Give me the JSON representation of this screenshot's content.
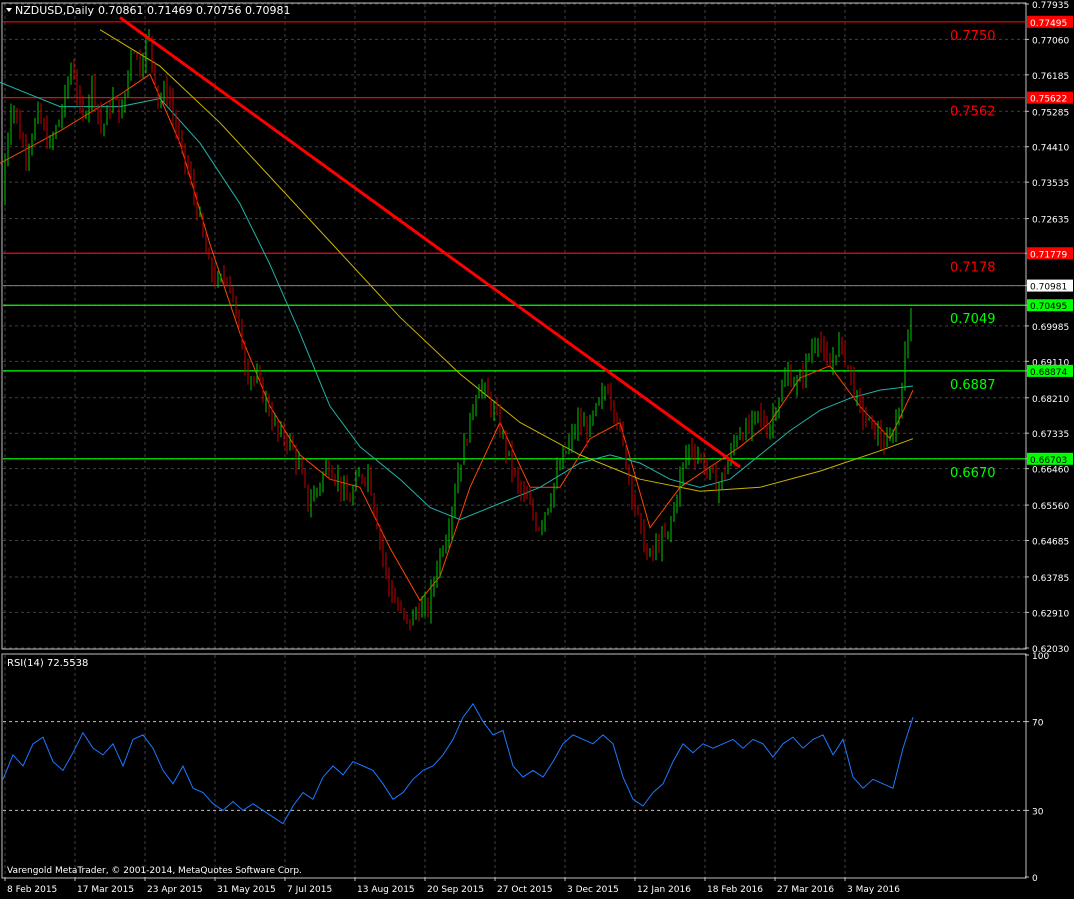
{
  "header": {
    "symbol": "NZDUSD,Daily",
    "ohlc": "0.70861 0.71469 0.70756 0.70981"
  },
  "copyright": "Varengold MetaTrader, © 2001-2014, MetaQuotes Software Corp.",
  "colors": {
    "background": "#000000",
    "grid": "#404040",
    "bull": "#00c800",
    "bear": "#c80000",
    "trendline": "#ff0000",
    "resistance": "#ff0000",
    "support": "#00ff00",
    "ma_fast": "#ff4500",
    "ma_mid": "#20b2aa",
    "ma_slow": "#c8b400",
    "rsi": "#1e78ff"
  },
  "chart_data": [
    {
      "type": "candlestick",
      "symbol": "NZDUSD",
      "timeframe": "Daily",
      "ylim": [
        0.6203,
        0.77935
      ],
      "y_ticks": [
        "0.77935",
        "0.77060",
        "0.76185",
        "0.75285",
        "0.74410",
        "0.73535",
        "0.72635",
        "0.71779",
        "0.70981",
        "0.70495",
        "0.69985",
        "0.69110",
        "0.68874",
        "0.68210",
        "0.67335",
        "0.66703",
        "0.66460",
        "0.65560",
        "0.64685",
        "0.63785",
        "0.62910",
        "0.62030"
      ],
      "x_tick_labels": [
        "8 Feb 2015",
        "17 Mar 2015",
        "23 Apr 2015",
        "31 May 2015",
        "7 Jul 2015",
        "13 Aug 2015",
        "20 Sep 2015",
        "27 Oct 2015",
        "3 Dec 2015",
        "12 Jan 2016",
        "18 Feb 2016",
        "27 Mar 2016",
        "3 May 2016"
      ],
      "price_path": [
        [
          0,
          0.73
        ],
        [
          12,
          0.756
        ],
        [
          25,
          0.742
        ],
        [
          38,
          0.752
        ],
        [
          50,
          0.744
        ],
        [
          62,
          0.753
        ],
        [
          72,
          0.765
        ],
        [
          82,
          0.75
        ],
        [
          92,
          0.76
        ],
        [
          102,
          0.748
        ],
        [
          112,
          0.756
        ],
        [
          122,
          0.752
        ],
        [
          132,
          0.77
        ],
        [
          140,
          0.764
        ],
        [
          148,
          0.772
        ],
        [
          158,
          0.756
        ],
        [
          168,
          0.758
        ],
        [
          178,
          0.746
        ],
        [
          188,
          0.738
        ],
        [
          198,
          0.728
        ],
        [
          208,
          0.715
        ],
        [
          218,
          0.71
        ],
        [
          228,
          0.713
        ],
        [
          238,
          0.7
        ],
        [
          248,
          0.688
        ],
        [
          258,
          0.686
        ],
        [
          268,
          0.68
        ],
        [
          278,
          0.673
        ],
        [
          288,
          0.672
        ],
        [
          298,
          0.666
        ],
        [
          308,
          0.656
        ],
        [
          318,
          0.66
        ],
        [
          328,
          0.666
        ],
        [
          338,
          0.662
        ],
        [
          348,
          0.656
        ],
        [
          358,
          0.662
        ],
        [
          368,
          0.664
        ],
        [
          378,
          0.65
        ],
        [
          388,
          0.636
        ],
        [
          398,
          0.63
        ],
        [
          408,
          0.626
        ],
        [
          418,
          0.63
        ],
        [
          428,
          0.63
        ],
        [
          438,
          0.642
        ],
        [
          448,
          0.65
        ],
        [
          458,
          0.664
        ],
        [
          468,
          0.674
        ],
        [
          478,
          0.686
        ],
        [
          488,
          0.682
        ],
        [
          498,
          0.676
        ],
        [
          508,
          0.668
        ],
        [
          518,
          0.66
        ],
        [
          528,
          0.656
        ],
        [
          538,
          0.65
        ],
        [
          548,
          0.656
        ],
        [
          558,
          0.664
        ],
        [
          568,
          0.67
        ],
        [
          578,
          0.676
        ],
        [
          588,
          0.674
        ],
        [
          598,
          0.68
        ],
        [
          608,
          0.685
        ],
        [
          618,
          0.676
        ],
        [
          628,
          0.664
        ],
        [
          638,
          0.652
        ],
        [
          648,
          0.642
        ],
        [
          658,
          0.646
        ],
        [
          668,
          0.648
        ],
        [
          678,
          0.66
        ],
        [
          688,
          0.67
        ],
        [
          698,
          0.668
        ],
        [
          708,
          0.664
        ],
        [
          718,
          0.66
        ],
        [
          728,
          0.666
        ],
        [
          738,
          0.674
        ],
        [
          748,
          0.674
        ],
        [
          758,
          0.678
        ],
        [
          768,
          0.674
        ],
        [
          778,
          0.682
        ],
        [
          788,
          0.688
        ],
        [
          798,
          0.685
        ],
        [
          808,
          0.692
        ],
        [
          818,
          0.698
        ],
        [
          828,
          0.688
        ],
        [
          838,
          0.696
        ],
        [
          848,
          0.69
        ],
        [
          858,
          0.68
        ],
        [
          868,
          0.676
        ],
        [
          878,
          0.673
        ],
        [
          888,
          0.67
        ],
        [
          898,
          0.678
        ],
        [
          906,
          0.694
        ],
        [
          912,
          0.708
        ]
      ],
      "ma_fast": [
        [
          0,
          0.74
        ],
        [
          60,
          0.748
        ],
        [
          120,
          0.757
        ],
        [
          150,
          0.762
        ],
        [
          180,
          0.745
        ],
        [
          210,
          0.72
        ],
        [
          240,
          0.698
        ],
        [
          270,
          0.68
        ],
        [
          300,
          0.668
        ],
        [
          330,
          0.662
        ],
        [
          360,
          0.66
        ],
        [
          390,
          0.645
        ],
        [
          420,
          0.632
        ],
        [
          440,
          0.638
        ],
        [
          470,
          0.66
        ],
        [
          500,
          0.676
        ],
        [
          530,
          0.66
        ],
        [
          560,
          0.66
        ],
        [
          590,
          0.672
        ],
        [
          620,
          0.676
        ],
        [
          650,
          0.65
        ],
        [
          680,
          0.66
        ],
        [
          710,
          0.665
        ],
        [
          740,
          0.67
        ],
        [
          770,
          0.676
        ],
        [
          800,
          0.687
        ],
        [
          830,
          0.69
        ],
        [
          860,
          0.68
        ],
        [
          890,
          0.672
        ],
        [
          913,
          0.684
        ]
      ],
      "ma_mid": [
        [
          0,
          0.76
        ],
        [
          60,
          0.754
        ],
        [
          120,
          0.754
        ],
        [
          160,
          0.756
        ],
        [
          200,
          0.745
        ],
        [
          240,
          0.73
        ],
        [
          270,
          0.715
        ],
        [
          300,
          0.698
        ],
        [
          330,
          0.68
        ],
        [
          360,
          0.67
        ],
        [
          400,
          0.662
        ],
        [
          430,
          0.655
        ],
        [
          460,
          0.652
        ],
        [
          500,
          0.656
        ],
        [
          540,
          0.66
        ],
        [
          580,
          0.666
        ],
        [
          610,
          0.668
        ],
        [
          640,
          0.666
        ],
        [
          670,
          0.662
        ],
        [
          700,
          0.66
        ],
        [
          730,
          0.662
        ],
        [
          760,
          0.668
        ],
        [
          790,
          0.674
        ],
        [
          820,
          0.679
        ],
        [
          850,
          0.682
        ],
        [
          880,
          0.684
        ],
        [
          913,
          0.685
        ]
      ],
      "ma_slow": [
        [
          100,
          0.773
        ],
        [
          160,
          0.764
        ],
        [
          220,
          0.75
        ],
        [
          280,
          0.734
        ],
        [
          340,
          0.718
        ],
        [
          400,
          0.702
        ],
        [
          460,
          0.688
        ],
        [
          520,
          0.676
        ],
        [
          580,
          0.668
        ],
        [
          640,
          0.662
        ],
        [
          700,
          0.659
        ],
        [
          760,
          0.66
        ],
        [
          820,
          0.664
        ],
        [
          880,
          0.669
        ],
        [
          913,
          0.672
        ]
      ],
      "trendline": {
        "from": [
          0.776,
          0
        ],
        "to": [
          0.665,
          1
        ]
      },
      "levels": [
        {
          "value": 0.77495,
          "label": "0.7750",
          "axis_label": "0.77495",
          "kind": "resistance"
        },
        {
          "value": 0.75622,
          "label": "0.7562",
          "axis_label": "0.75622",
          "kind": "resistance"
        },
        {
          "value": 0.71779,
          "label": "0.7178",
          "axis_label": "0.71779",
          "kind": "resistance"
        },
        {
          "value": 0.70495,
          "label": "0.7049",
          "axis_label": "0.70495",
          "kind": "support"
        },
        {
          "value": 0.68874,
          "label": "0.6887",
          "axis_label": "0.68874",
          "kind": "support"
        },
        {
          "value": 0.66703,
          "label": "0.6670",
          "axis_label": "0.66703",
          "kind": "support"
        }
      ],
      "current_price": {
        "value": 0.70981,
        "label": "0.70981"
      }
    },
    {
      "type": "line",
      "title": "RSI(14) 72.5538",
      "ylim": [
        0,
        100
      ],
      "y_ticks": [
        "100",
        "70",
        "30",
        "0"
      ],
      "levels": [
        70,
        30
      ],
      "series": [
        {
          "values": [
            [
              0,
              44
            ],
            [
              10,
              55
            ],
            [
              20,
              50
            ],
            [
              30,
              60
            ],
            [
              40,
              63
            ],
            [
              50,
              52
            ],
            [
              60,
              48
            ],
            [
              70,
              56
            ],
            [
              80,
              65
            ],
            [
              90,
              58
            ],
            [
              100,
              55
            ],
            [
              110,
              60
            ],
            [
              120,
              50
            ],
            [
              130,
              62
            ],
            [
              140,
              64
            ],
            [
              150,
              58
            ],
            [
              160,
              48
            ],
            [
              170,
              42
            ],
            [
              180,
              50
            ],
            [
              190,
              40
            ],
            [
              200,
              38
            ],
            [
              210,
              33
            ],
            [
              220,
              30
            ],
            [
              230,
              34
            ],
            [
              240,
              30
            ],
            [
              250,
              33
            ],
            [
              260,
              30
            ],
            [
              270,
              27
            ],
            [
              280,
              24
            ],
            [
              290,
              32
            ],
            [
              300,
              38
            ],
            [
              310,
              35
            ],
            [
              320,
              45
            ],
            [
              330,
              50
            ],
            [
              340,
              46
            ],
            [
              350,
              52
            ],
            [
              360,
              50
            ],
            [
              370,
              48
            ],
            [
              380,
              42
            ],
            [
              390,
              35
            ],
            [
              400,
              38
            ],
            [
              410,
              44
            ],
            [
              420,
              48
            ],
            [
              430,
              50
            ],
            [
              440,
              55
            ],
            [
              450,
              62
            ],
            [
              460,
              72
            ],
            [
              470,
              78
            ],
            [
              480,
              70
            ],
            [
              490,
              64
            ],
            [
              500,
              66
            ],
            [
              510,
              50
            ],
            [
              520,
              45
            ],
            [
              530,
              48
            ],
            [
              540,
              45
            ],
            [
              550,
              52
            ],
            [
              560,
              60
            ],
            [
              570,
              64
            ],
            [
              580,
              62
            ],
            [
              590,
              60
            ],
            [
              600,
              64
            ],
            [
              610,
              60
            ],
            [
              620,
              45
            ],
            [
              630,
              35
            ],
            [
              640,
              32
            ],
            [
              650,
              38
            ],
            [
              660,
              42
            ],
            [
              670,
              52
            ],
            [
              680,
              60
            ],
            [
              690,
              56
            ],
            [
              700,
              60
            ],
            [
              710,
              58
            ],
            [
              720,
              60
            ],
            [
              730,
              62
            ],
            [
              740,
              58
            ],
            [
              750,
              62
            ],
            [
              760,
              60
            ],
            [
              770,
              54
            ],
            [
              780,
              60
            ],
            [
              790,
              63
            ],
            [
              800,
              58
            ],
            [
              810,
              62
            ],
            [
              820,
              64
            ],
            [
              830,
              55
            ],
            [
              840,
              62
            ],
            [
              850,
              45
            ],
            [
              860,
              40
            ],
            [
              870,
              44
            ],
            [
              880,
              42
            ],
            [
              890,
              40
            ],
            [
              900,
              58
            ],
            [
              910,
              72
            ]
          ]
        }
      ]
    }
  ]
}
